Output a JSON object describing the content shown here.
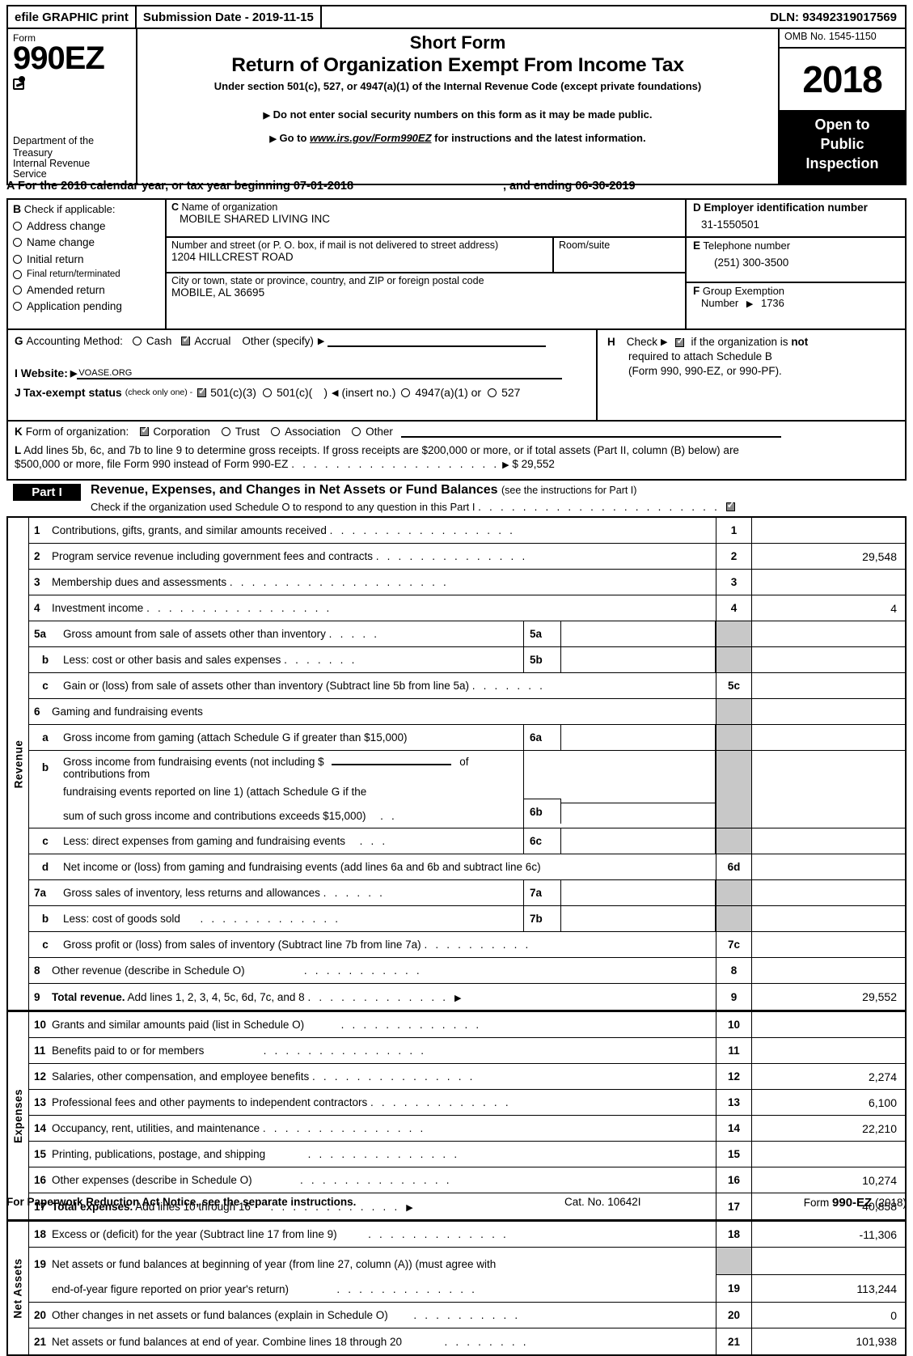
{
  "efile": {
    "graphic_print": "efile GRAPHIC print",
    "submission_date": "Submission Date - 2019-11-15",
    "dln": "DLN: 93492319017569"
  },
  "masthead": {
    "form_label": "Form",
    "form_number": "990EZ",
    "dept_line1": "Department of the",
    "dept_line2": "Treasury",
    "dept_line3": "Internal Revenue",
    "dept_line4": "Service",
    "short_form": "Short Form",
    "title": "Return of Organization Exempt From Income Tax",
    "under_section": "Under section 501(c), 527, or 4947(a)(1) of the Internal Revenue Code (except private foundations)",
    "bullet1": "Do not enter social security numbers on this form as it may be made public.",
    "bullet2_pre": "Go to ",
    "bullet2_link": "www.irs.gov/Form990EZ",
    "bullet2_post": " for instructions and the latest information.",
    "omb": "OMB No. 1545-1150",
    "year": "2018",
    "open_line1": "Open to",
    "open_line2": "Public",
    "open_line3": "Inspection"
  },
  "line_a": {
    "letter": "A",
    "text_pre": "For the 2018 calendar year, or tax year beginning",
    "begin_date": "07-01-2018",
    "text_mid": ", and ending",
    "end_date": "06-30-2019"
  },
  "section_b": {
    "letter": "B",
    "heading": "Check if applicable:",
    "items": [
      {
        "label": "Address change",
        "checked": false
      },
      {
        "label": "Name change",
        "checked": false
      },
      {
        "label": "Initial return",
        "checked": false
      },
      {
        "label": "Final return/terminated",
        "checked": false
      },
      {
        "label": "Amended return",
        "checked": false
      },
      {
        "label": "Application pending",
        "checked": false
      }
    ]
  },
  "section_c": {
    "letter": "C",
    "name_label": "Name of organization",
    "name_value": "MOBILE SHARED LIVING INC",
    "street_label": "Number and street (or P. O. box, if mail is not delivered to street address)",
    "street_value": "1204 HILLCREST ROAD",
    "room_label": "Room/suite",
    "room_value": "",
    "city_label": "City or town, state or province, country, and ZIP or foreign postal code",
    "city_value": "MOBILE, AL   36695"
  },
  "section_d": {
    "letter": "D",
    "ein_label": "Employer identification number",
    "ein_value": "31-1550501",
    "tel_letter": "E",
    "tel_label": "Telephone number",
    "tel_value": "(251) 300-3500",
    "grp_letter": "F",
    "grp_label1": "Group Exemption",
    "grp_label2": "Number",
    "grp_value": "1736"
  },
  "section_g": {
    "letter": "G",
    "label": "Accounting Method:",
    "cash_label": "Cash",
    "cash_checked": false,
    "accrual_label": "Accrual",
    "accrual_checked": true,
    "other_label": "Other (specify)"
  },
  "section_h": {
    "letter": "H",
    "check_label": "Check",
    "checked": true,
    "text1_pre": "if the organization is ",
    "text1_bold": "not",
    "text2": "required to attach Schedule B",
    "text3": "(Form 990, 990-EZ, or 990-PF)."
  },
  "section_i": {
    "letter": "I",
    "label": "Website:",
    "value": "VOASE.ORG"
  },
  "section_j": {
    "letter": "J",
    "label": "Tax-exempt status",
    "note": "(check only one) -",
    "opt1": "501(c)(3)",
    "opt1_checked": true,
    "opt2": "501(c)(",
    "opt2_checked": false,
    "opt2_tail": ")",
    "insert": "(insert no.)",
    "opt3": "4947(a)(1) or",
    "opt3_checked": false,
    "opt4": "527",
    "opt4_checked": false
  },
  "section_k": {
    "letter": "K",
    "label": "Form of organization:",
    "options": [
      {
        "label": "Corporation",
        "checked": true
      },
      {
        "label": "Trust",
        "checked": false
      },
      {
        "label": "Association",
        "checked": false
      },
      {
        "label": "Other",
        "checked": false
      }
    ]
  },
  "section_l": {
    "letter": "L",
    "line1": "Add lines 5b, 6c, and 7b to line 9 to determine gross receipts. If gross receipts are $200,000 or more, or if total assets (Part II, column (B) below) are",
    "line2": "$500,000 or more, file Form 990 instead of Form 990-EZ",
    "amount": "$ 29,552"
  },
  "part1": {
    "tag": "Part I",
    "title": "Revenue, Expenses, and Changes in Net Assets or Fund Balances",
    "title_note": "(see the instructions for Part I)",
    "subtitle": "Check if the organization used Schedule O to respond to any question in this Part I",
    "sched_o_checked": true
  },
  "side_labels": {
    "revenue": "Revenue",
    "expenses": "Expenses",
    "net_assets": "Net Assets"
  },
  "revenue_rows": [
    {
      "num": "1",
      "indent": false,
      "text": "Contributions, gifts, grants, and similar amounts received",
      "dots": 17,
      "numcell": "1",
      "amount": ""
    },
    {
      "num": "2",
      "indent": false,
      "text": "Program service revenue including government fees and contracts",
      "dots": 14,
      "numcell": "2",
      "amount": "29,548"
    },
    {
      "num": "3",
      "indent": false,
      "text": "Membership dues and assessments",
      "dots": 20,
      "numcell": "3",
      "amount": ""
    },
    {
      "num": "4",
      "indent": false,
      "text": "Investment income",
      "dots": 17,
      "numcell": "4",
      "amount": ""
    }
  ],
  "line4_amount": "4",
  "rows_5": {
    "a": {
      "num": "5a",
      "text": "Gross amount from sale of assets other than inventory",
      "dots": 5,
      "sub": "5a",
      "subval": ""
    },
    "b": {
      "num": "b",
      "text": "Less: cost or other basis and sales expenses",
      "dots": 7,
      "sub": "5b",
      "subval": ""
    },
    "c": {
      "num": "c",
      "text": "Gain or (loss) from sale of assets other than inventory (Subtract line 5b from line 5a)",
      "dots": 7,
      "numcell": "5c",
      "amount": ""
    }
  },
  "rows_6": {
    "head": {
      "num": "6",
      "text": "Gaming and fundraising events"
    },
    "a": {
      "num": "a",
      "text": "Gross income from gaming (attach Schedule G if greater than $15,000)",
      "sub": "6a",
      "subval": ""
    },
    "b": {
      "num": "b",
      "l1_pre": "Gross income from fundraising events (not including $",
      "l1_post": "of contributions from",
      "l2": "fundraising events reported on line 1) (attach Schedule G if the",
      "l3": "sum of such gross income and contributions exceeds $15,000)",
      "dots": 2,
      "sub": "6b",
      "subval": ""
    },
    "c": {
      "num": "c",
      "text": "Less: direct expenses from gaming and fundraising events",
      "dots": 3,
      "sub": "6c",
      "subval": ""
    },
    "d": {
      "num": "d",
      "text": "Net income or (loss) from gaming and fundraising events (add lines 6a and 6b and subtract line 6c)",
      "numcell": "6d",
      "amount": ""
    }
  },
  "rows_7": {
    "a": {
      "num": "7a",
      "text": "Gross sales of inventory, less returns and allowances",
      "dots": 6,
      "sub": "7a",
      "subval": ""
    },
    "b": {
      "num": "b",
      "text": "Less: cost of goods sold",
      "dots": 13,
      "sub": "7b",
      "subval": ""
    },
    "c": {
      "num": "c",
      "text": "Gross profit or (loss) from sales of inventory (Subtract line 7b from line 7a)",
      "dots": 10,
      "numcell": "7c",
      "amount": ""
    }
  },
  "row_8": {
    "num": "8",
    "text": "Other revenue (describe in Schedule O)",
    "dots": 11,
    "numcell": "8",
    "amount": ""
  },
  "row_9": {
    "num": "9",
    "text_bold": "Total revenue.",
    "text": " Add lines 1, 2, 3, 4, 5c, 6d, 7c, and 8",
    "dots": 13,
    "numcell": "9",
    "amount": "29,552"
  },
  "expense_rows": [
    {
      "num": "10",
      "text": "Grants and similar amounts paid (list in Schedule O)",
      "dots": 13,
      "numcell": "10",
      "amount": ""
    },
    {
      "num": "11",
      "text": "Benefits paid to or for members",
      "dots": 15,
      "numcell": "11",
      "amount": ""
    },
    {
      "num": "12",
      "text": "Salaries, other compensation, and employee benefits",
      "dots": 15,
      "numcell": "12",
      "amount": "2,274"
    },
    {
      "num": "13",
      "text": "Professional fees and other payments to independent contractors",
      "dots": 13,
      "numcell": "13",
      "amount": "6,100"
    },
    {
      "num": "14",
      "text": "Occupancy, rent, utilities, and maintenance",
      "dots": 15,
      "numcell": "14",
      "amount": "22,210"
    },
    {
      "num": "15",
      "text": "Printing, publications, postage, and shipping",
      "dots": 14,
      "numcell": "15",
      "amount": ""
    },
    {
      "num": "16",
      "text": "Other expenses (describe in Schedule O)",
      "dots": 14,
      "numcell": "16",
      "amount": "10,274"
    }
  ],
  "row_17": {
    "num": "17",
    "text_bold": "Total expenses.",
    "text": " Add lines 10 through 16",
    "dots": 12,
    "numcell": "17",
    "amount": "40,858"
  },
  "netasset_rows": {
    "r18": {
      "num": "18",
      "text": "Excess or (deficit) for the year (Subtract line 17 from line 9)",
      "dots": 13,
      "numcell": "18",
      "amount": "-11,306"
    },
    "r19": {
      "num": "19",
      "l1": "Net assets or fund balances at beginning of year (from line 27, column (A)) (must agree with",
      "l2": "end-of-year figure reported on prior year's return)",
      "dots": 13,
      "numcell": "19",
      "amount": "113,244"
    },
    "r20": {
      "num": "20",
      "text": "Other changes in net assets or fund balances (explain in Schedule O)",
      "dots": 10,
      "numcell": "20",
      "amount": "0"
    },
    "r21": {
      "num": "21",
      "text": "Net assets or fund balances at end of year. Combine lines 18 through 20",
      "dots": 8,
      "numcell": "21",
      "amount": "101,938"
    }
  },
  "footer": {
    "left": "For Paperwork Reduction Act Notice, see the separate instructions.",
    "center": "Cat. No. 10642I",
    "right_pre": "Form ",
    "right_bold": "990-EZ",
    "right_post": " (2018)"
  }
}
